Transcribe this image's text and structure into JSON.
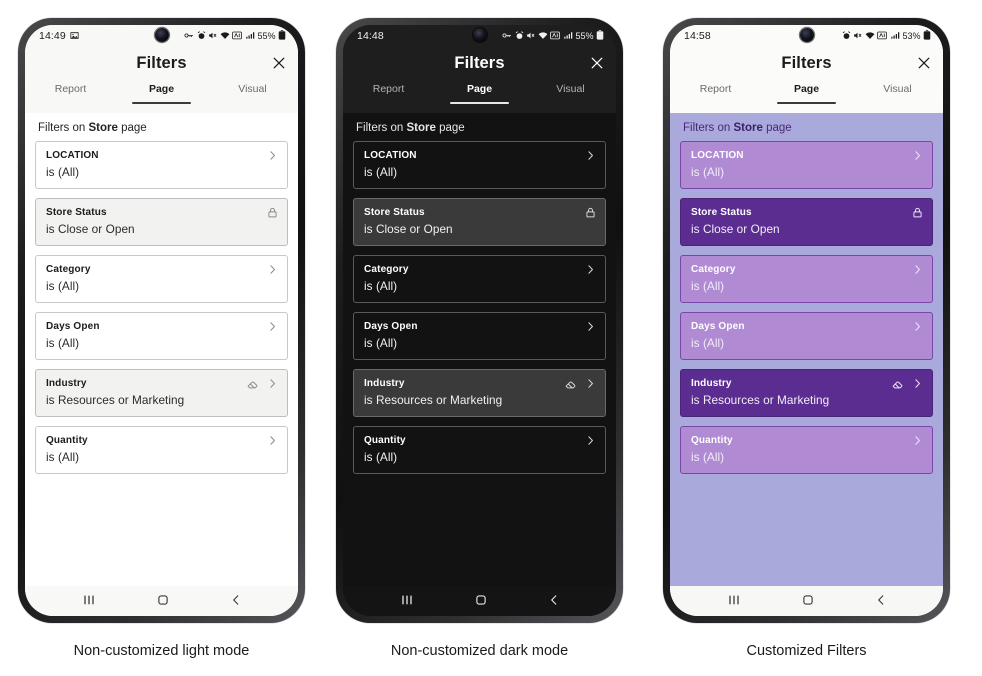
{
  "phones": [
    {
      "id": "light",
      "theme": "theme-light",
      "caption": "Non-customized light mode",
      "status": {
        "clock": "14:49",
        "left_icons": [
          "image-icon"
        ],
        "right_icons": [
          "vpn-key-icon",
          "alarm-icon",
          "mute-icon",
          "wifi-icon",
          "nfc-icon",
          "signal-icon"
        ],
        "battery": "55%",
        "battery_icon": "battery-lock-icon"
      },
      "header": {
        "title": "Filters",
        "close_icon": "close-icon"
      },
      "tabs": [
        {
          "label": "Report",
          "active": false
        },
        {
          "label": "Page",
          "active": true
        },
        {
          "label": "Visual",
          "active": false
        }
      ],
      "subtitle": {
        "prefix": "Filters on ",
        "page": "Store",
        "suffix": " page"
      },
      "cards": [
        {
          "title": "LOCATION",
          "value": "is (All)",
          "style": "plain",
          "icons": [
            "chevron-right-icon"
          ]
        },
        {
          "title": "Store Status",
          "value": "is Close or Open",
          "style": "locked",
          "icons": [
            "lock-icon"
          ]
        },
        {
          "title": "Category",
          "value": "is (All)",
          "style": "plain",
          "icons": [
            "chevron-right-icon"
          ]
        },
        {
          "title": "Days Open",
          "value": "is (All)",
          "style": "plain",
          "icons": [
            "chevron-right-icon"
          ]
        },
        {
          "title": "Industry",
          "value": "is Resources or Marketing",
          "style": "highlighted",
          "icons": [
            "eraser-icon",
            "chevron-right-icon"
          ]
        },
        {
          "title": "Quantity",
          "value": "is (All)",
          "style": "plain",
          "icons": [
            "chevron-right-icon"
          ]
        }
      ],
      "nav": [
        "recents-icon",
        "home-icon",
        "back-icon"
      ]
    },
    {
      "id": "dark",
      "theme": "theme-dark",
      "caption": "Non-customized dark mode",
      "status": {
        "clock": "14:48",
        "left_icons": [],
        "right_icons": [
          "vpn-key-icon",
          "alarm-icon",
          "mute-icon",
          "wifi-icon",
          "nfc-icon",
          "signal-icon"
        ],
        "battery": "55%",
        "battery_icon": "battery-lock-icon"
      },
      "header": {
        "title": "Filters",
        "close_icon": "close-icon"
      },
      "tabs": [
        {
          "label": "Report",
          "active": false
        },
        {
          "label": "Page",
          "active": true
        },
        {
          "label": "Visual",
          "active": false
        }
      ],
      "subtitle": {
        "prefix": "Filters on ",
        "page": "Store",
        "suffix": " page"
      },
      "cards": [
        {
          "title": "LOCATION",
          "value": "is (All)",
          "style": "plain",
          "icons": [
            "chevron-right-icon"
          ]
        },
        {
          "title": "Store Status",
          "value": "is Close or Open",
          "style": "locked",
          "icons": [
            "lock-icon"
          ]
        },
        {
          "title": "Category",
          "value": "is (All)",
          "style": "plain",
          "icons": [
            "chevron-right-icon"
          ]
        },
        {
          "title": "Days Open",
          "value": "is (All)",
          "style": "plain",
          "icons": [
            "chevron-right-icon"
          ]
        },
        {
          "title": "Industry",
          "value": "is Resources or Marketing",
          "style": "highlighted",
          "icons": [
            "eraser-icon",
            "chevron-right-icon"
          ]
        },
        {
          "title": "Quantity",
          "value": "is (All)",
          "style": "plain",
          "icons": [
            "chevron-right-icon"
          ]
        }
      ],
      "nav": [
        "recents-icon",
        "home-icon",
        "back-icon"
      ]
    },
    {
      "id": "custom",
      "theme": "theme-custom",
      "caption": "Customized Filters",
      "status": {
        "clock": "14:58",
        "left_icons": [],
        "right_icons": [
          "alarm-icon",
          "mute-icon",
          "wifi-icon",
          "nfc-icon",
          "signal-icon"
        ],
        "battery": "53%",
        "battery_icon": "battery-icon"
      },
      "header": {
        "title": "Filters",
        "close_icon": "close-icon"
      },
      "tabs": [
        {
          "label": "Report",
          "active": false
        },
        {
          "label": "Page",
          "active": true
        },
        {
          "label": "Visual",
          "active": false
        }
      ],
      "subtitle": {
        "prefix": "Filters on ",
        "page": "Store",
        "suffix": " page"
      },
      "cards": [
        {
          "title": "LOCATION",
          "value": "is (All)",
          "style": "plain",
          "icons": [
            "chevron-right-icon"
          ]
        },
        {
          "title": "Store Status",
          "value": "is Close or Open",
          "style": "locked",
          "icons": [
            "lock-icon"
          ]
        },
        {
          "title": "Category",
          "value": "is (All)",
          "style": "plain",
          "icons": [
            "chevron-right-icon"
          ]
        },
        {
          "title": "Days Open",
          "value": "is (All)",
          "style": "plain",
          "icons": [
            "chevron-right-icon"
          ]
        },
        {
          "title": "Industry",
          "value": "is Resources or Marketing",
          "style": "highlighted",
          "icons": [
            "eraser-icon",
            "chevron-right-icon"
          ]
        },
        {
          "title": "Quantity",
          "value": "is (All)",
          "style": "plain",
          "icons": [
            "chevron-right-icon"
          ]
        }
      ],
      "nav": [
        "recents-icon",
        "home-icon",
        "back-icon"
      ]
    }
  ],
  "colors": {
    "light_card_bg": "#ffffff",
    "light_card_highlight": "#f2f2f0",
    "dark_screen_bg": "#121212",
    "dark_card_highlight": "#3a3a3a",
    "custom_body_bg": "#a9a9db",
    "custom_card_bg": "#b08bd4",
    "custom_card_highlight": "#5b2d91",
    "custom_subtitle_text": "#4b2878"
  }
}
